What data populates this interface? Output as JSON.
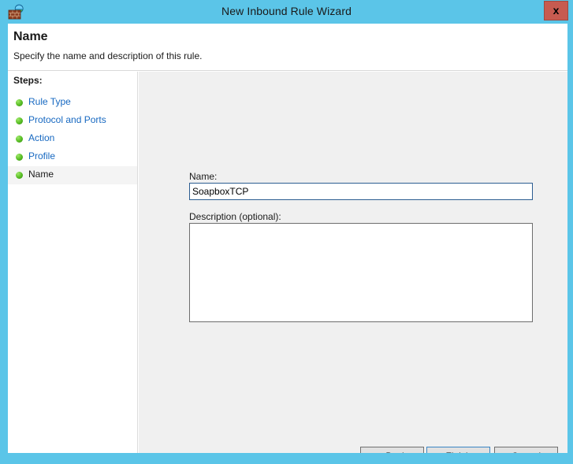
{
  "window": {
    "title": "New Inbound Rule Wizard",
    "icon": "firewall-brick-globe-icon",
    "close_label": "x",
    "accent_color": "#5bc5e8",
    "close_button_color": "#c75b50"
  },
  "header": {
    "title": "Name",
    "subtitle": "Specify the name and description of this rule."
  },
  "sidebar": {
    "heading": "Steps:",
    "items": [
      {
        "label": "Rule Type",
        "current": false
      },
      {
        "label": "Protocol and Ports",
        "current": false
      },
      {
        "label": "Action",
        "current": false
      },
      {
        "label": "Profile",
        "current": false
      },
      {
        "label": "Name",
        "current": true
      }
    ],
    "link_color": "#1668c1",
    "bullet_color": "#5fc22a"
  },
  "form": {
    "name_label": "Name:",
    "name_value": "SoapboxTCP",
    "name_placeholder": "",
    "description_label": "Description (optional):",
    "description_value": "",
    "description_placeholder": ""
  },
  "buttons": {
    "back": "< Back",
    "finish": "Finish",
    "cancel": "Cancel"
  }
}
